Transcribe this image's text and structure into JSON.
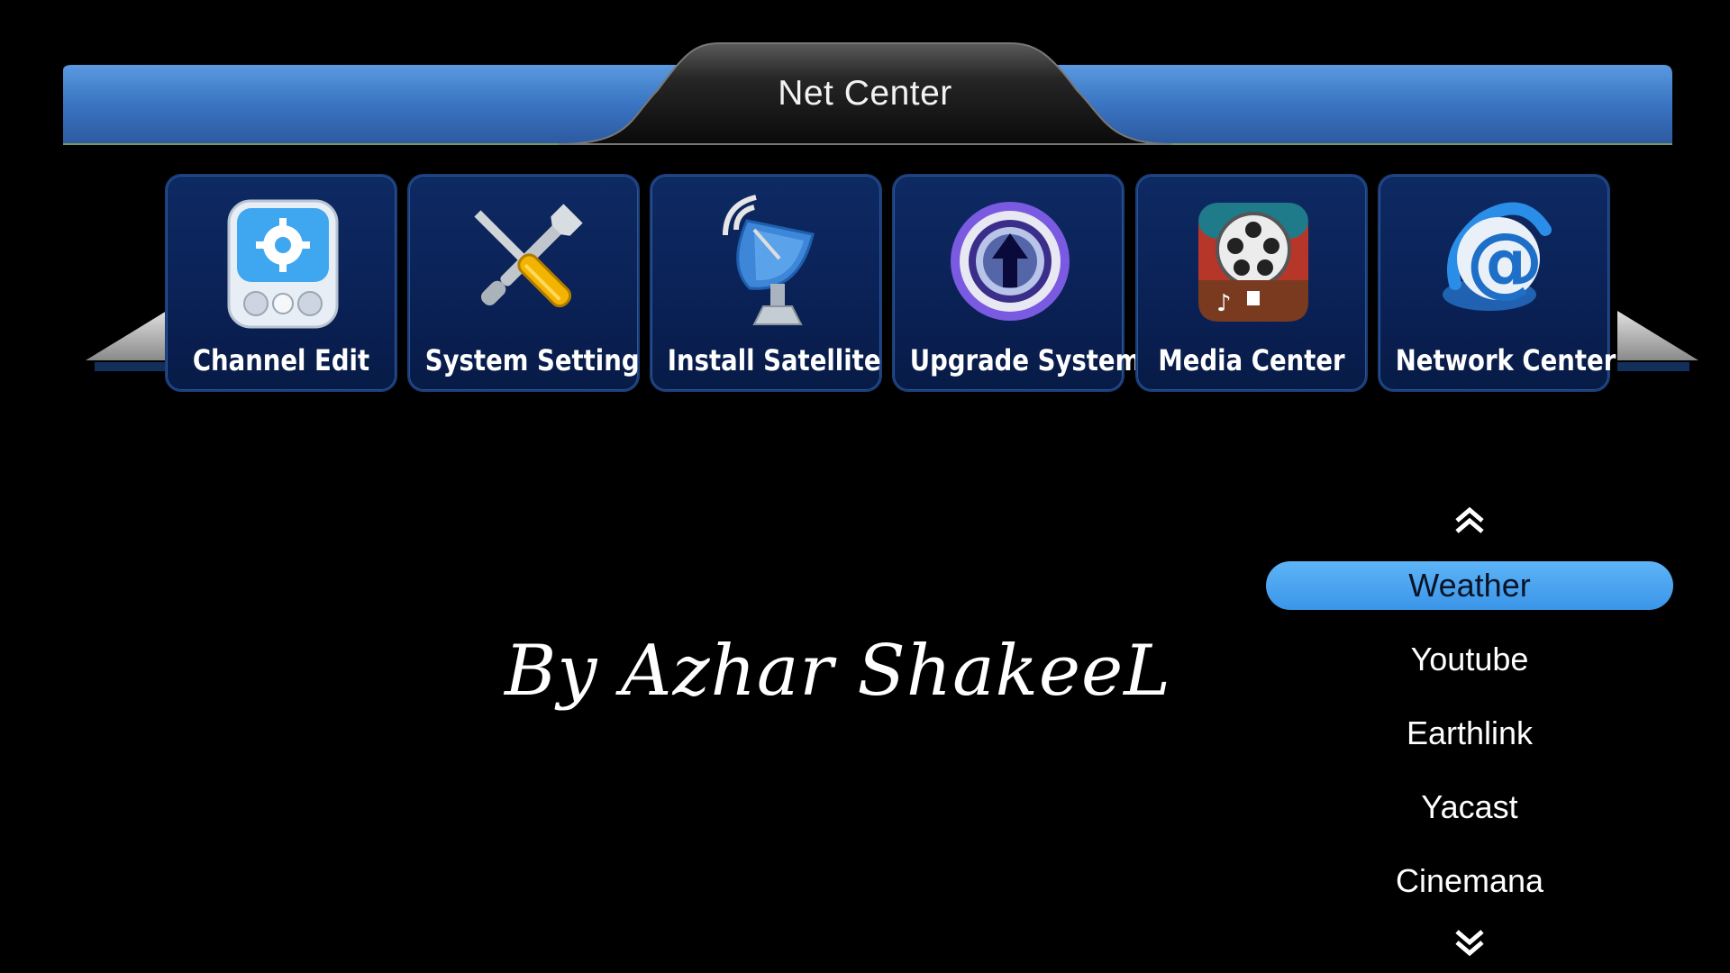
{
  "header": {
    "title": "Net Center"
  },
  "menu": {
    "items": [
      {
        "label": "Channel Edit",
        "icon": "channel-edit-icon"
      },
      {
        "label": "System Setting",
        "icon": "tools-icon"
      },
      {
        "label": "Install Satellite",
        "icon": "satellite-dish-icon"
      },
      {
        "label": "Upgrade System",
        "icon": "upgrade-arrow-icon"
      },
      {
        "label": "Media Center",
        "icon": "film-reel-icon"
      },
      {
        "label": "Network Center",
        "icon": "at-sign-icon"
      }
    ]
  },
  "watermark": {
    "text": "By Azhar ShakeeL"
  },
  "list": {
    "items": [
      "Weather",
      "Youtube",
      "Earthlink",
      "Yacast",
      "Cinemana"
    ],
    "selected": "Weather"
  },
  "colors": {
    "header_blue": "#3f7fd0",
    "tile_bg": "#0c2460",
    "selection": "#4aa5f0",
    "background": "#000000"
  }
}
